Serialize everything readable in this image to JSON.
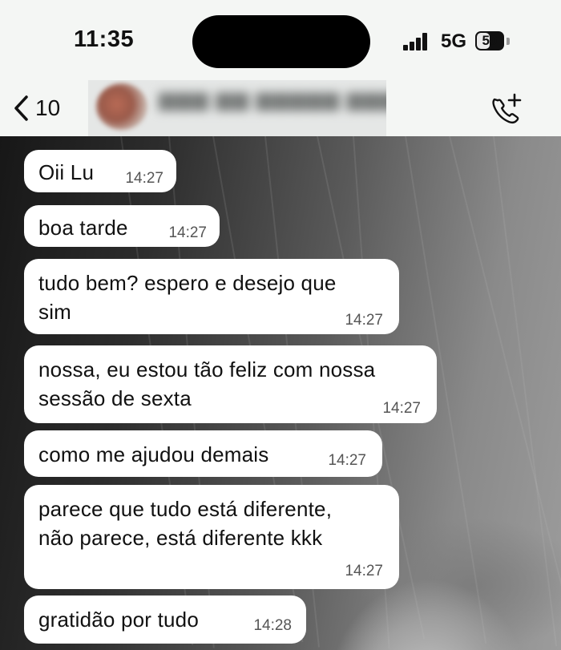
{
  "status_bar": {
    "time": "11:35",
    "network": "5G",
    "battery": "50",
    "battery_level": 0.5
  },
  "header": {
    "back_count": "10",
    "back_icon": "chevron-left-icon",
    "call_icon": "phone-add-icon"
  },
  "messages": [
    {
      "lines": [
        "Oii Lu"
      ],
      "time": "14:27"
    },
    {
      "lines": [
        "boa tarde"
      ],
      "time": "14:27"
    },
    {
      "lines": [
        "tudo bem? espero e desejo que",
        "sim"
      ],
      "time": "14:27"
    },
    {
      "lines": [
        "nossa, eu estou tão feliz com nossa",
        "sessão de sexta"
      ],
      "time": "14:27"
    },
    {
      "lines": [
        "como me ajudou demais"
      ],
      "time": "14:27"
    },
    {
      "lines": [
        "parece que tudo está diferente,",
        "não parece, está diferente kkk"
      ],
      "time": "14:27"
    },
    {
      "lines": [
        "gratidão por tudo"
      ],
      "time": "14:28"
    }
  ]
}
